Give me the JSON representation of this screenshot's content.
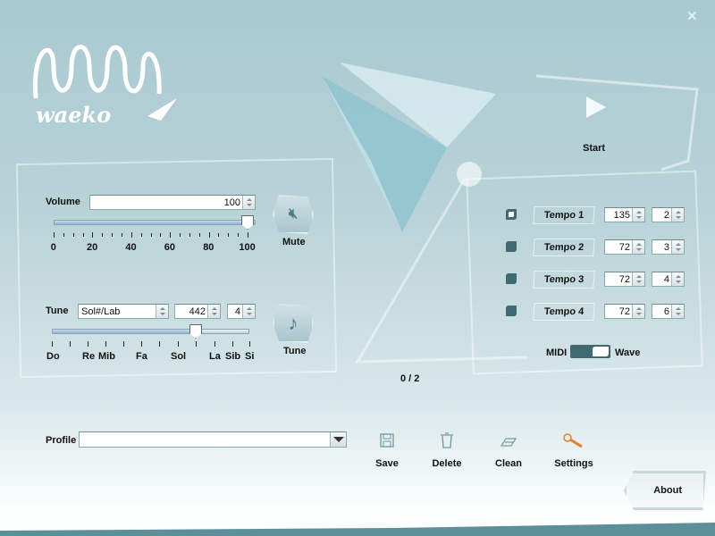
{
  "app": {
    "logo_text": "waeko",
    "close_icon": "close-icon"
  },
  "volume": {
    "label": "Volume",
    "value": "100",
    "slider_value": 100,
    "slider_min": 0,
    "slider_max": 100,
    "ticks": [
      "0",
      "20",
      "40",
      "60",
      "80",
      "100"
    ],
    "mute_label": "Mute"
  },
  "tune": {
    "label": "Tune",
    "note": "Sol#/Lab",
    "frequency": "442",
    "octave": "4",
    "slider_value": "La",
    "notes": [
      "Do",
      "Re",
      "Mib",
      "Fa",
      "Sol",
      "La",
      "Sib",
      "Si"
    ],
    "button_label": "Tune"
  },
  "start": {
    "label": "Start"
  },
  "tempos": [
    {
      "label": "Tempo 1",
      "bpm": "135",
      "beats": "2",
      "selected": true
    },
    {
      "label": "Tempo 2",
      "bpm": "72",
      "beats": "3",
      "selected": false
    },
    {
      "label": "Tempo 3",
      "bpm": "72",
      "beats": "4",
      "selected": false
    },
    {
      "label": "Tempo 4",
      "bpm": "72",
      "beats": "6",
      "selected": false
    }
  ],
  "mode": {
    "left": "MIDI",
    "right": "Wave",
    "selected": "Wave"
  },
  "counter": "0 / 2",
  "profile": {
    "label": "Profile",
    "value": ""
  },
  "toolbar": {
    "save": "Save",
    "delete": "Delete",
    "clean": "Clean",
    "settings": "Settings"
  },
  "about": "About",
  "colors": {
    "background": "#5b8f99",
    "accent": "#e8802a",
    "dark": "#3f6a72"
  }
}
